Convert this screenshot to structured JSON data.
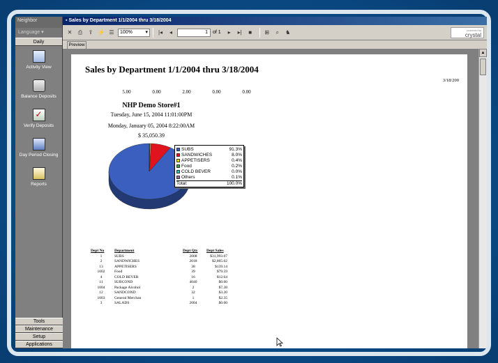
{
  "window": {
    "title": "Sales by Department 1/1/2004 thru 3/18/2004"
  },
  "nav": {
    "top_label": "Neighbor",
    "language_label": "Language",
    "section_daily": "Daily",
    "items": [
      {
        "label": "Activity View",
        "icon": "activity-view-icon"
      },
      {
        "label": "Balance Deposits",
        "icon": "balance-deposits-icon"
      },
      {
        "label": "Verify Deposits",
        "icon": "verify-deposits-icon"
      },
      {
        "label": "Day Period Closing",
        "icon": "day-period-closing-icon"
      },
      {
        "label": "Reports",
        "icon": "reports-icon"
      }
    ],
    "bottom_sections": [
      "Tools",
      "Maintenance",
      "Setup",
      "Applications"
    ]
  },
  "toolbar": {
    "zoom": "100%",
    "page_current": "1",
    "page_of": "of 1",
    "logo_small": "powered by",
    "logo": "crystal"
  },
  "tabs": {
    "preview": "Preview"
  },
  "report": {
    "title": "Sales by Department 1/1/2004 thru 3/18/2004",
    "print_date": "3/18/200",
    "numbers": [
      "5.00",
      "0.00",
      "2.00",
      "0.00",
      "0.00"
    ],
    "store_name": "NHP Demo Store#1",
    "date_line_1": "Tuesday, June 15, 2004  11:01:00PM",
    "date_line_2": "Monday, January 05, 2004   8:22:00AM",
    "total_line": "$ 35,050.39"
  },
  "chart_data": {
    "type": "pie",
    "series": [
      {
        "name": "SUBS",
        "value": 91.3,
        "label": "91.3%",
        "color": "#3a5fbf"
      },
      {
        "name": "SANDWICHES",
        "value": 8.0,
        "label": "8.0%",
        "color": "#e0141e"
      },
      {
        "name": "APPETISERS",
        "value": 0.4,
        "label": "0.4%",
        "color": "#e8d818"
      },
      {
        "name": "Food",
        "value": 0.2,
        "label": "0.2%",
        "color": "#3aa838"
      },
      {
        "name": "COLD BEVER",
        "value": 0.0,
        "label": "0.0%",
        "color": "#38b8c8"
      },
      {
        "name": "Others",
        "value": 0.1,
        "label": "0.1%",
        "color": "#a060b0"
      }
    ],
    "total_label": "Total:",
    "total_value": "100.0%"
  },
  "table": {
    "headers": [
      "Dept No",
      "Department",
      "Dept Qty",
      "Dept Sales"
    ],
    "rows": [
      [
        "1",
        "SUBS",
        "2008",
        "$31,993.07"
      ],
      [
        "2",
        "SANDWICHES",
        "2018",
        "$2,805.02"
      ],
      [
        "13",
        "APPETISERS",
        "38",
        "$139.14"
      ],
      [
        "1002",
        "Food",
        "39",
        "$79.59"
      ],
      [
        "4",
        "COLD BEVER",
        "16",
        "$12.64"
      ],
      [
        "11",
        "SUBCOND",
        "4040",
        "$0.00"
      ],
      [
        "1004",
        "Package Alcohol",
        "2",
        "$7.38"
      ],
      [
        "12",
        "SANDCOND",
        "32",
        "$3.20"
      ],
      [
        "1003",
        "General Merchan",
        "1",
        "$2.35"
      ],
      [
        "3",
        "SALADS",
        "2004",
        "$0.00"
      ]
    ]
  }
}
